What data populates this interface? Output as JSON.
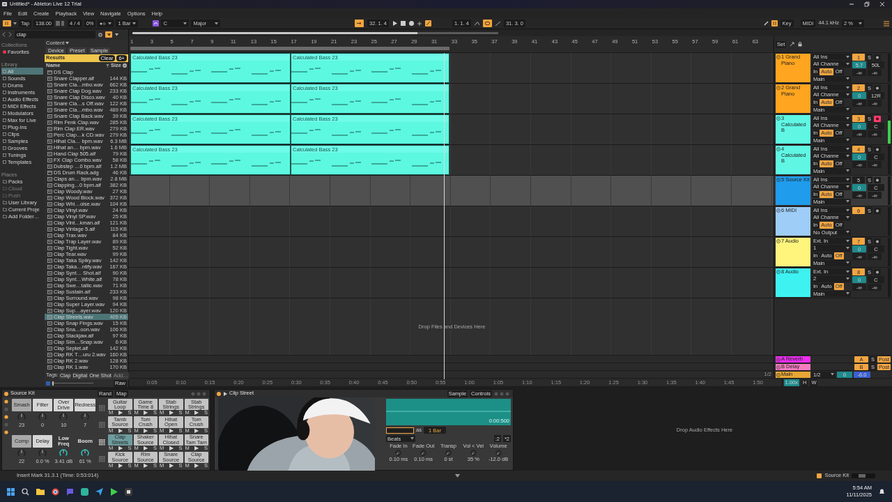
{
  "window": {
    "title": "Untitled* - Ableton Live 12 Trial"
  },
  "menu": [
    "File",
    "Edit",
    "Create",
    "Playback",
    "View",
    "Navigate",
    "Options",
    "Help"
  ],
  "transport": {
    "tap": "Tap",
    "tempo": "138.00",
    "signature": "4 / 4",
    "groove": "0%",
    "quantize": "1 Bar",
    "key": "C",
    "scale": "Major",
    "follow": true,
    "position": "32. 1. 4",
    "loop_start": "1. 1. 4",
    "loop": true,
    "loop_length": "31. 3. 0",
    "key_map": "Key",
    "midi_map": "MIDI",
    "sample_rate": "44.1 kHz",
    "cpu": "2 %"
  },
  "browser": {
    "search": "clap",
    "collections_title": "Collections",
    "favorites": "Favorites",
    "library_title": "Library",
    "library": [
      {
        "label": "All",
        "selected": true
      },
      {
        "label": "Sounds",
        "selected": false
      },
      {
        "label": "Drums",
        "selected": false
      },
      {
        "label": "Instruments",
        "selected": false
      },
      {
        "label": "Audio Effects",
        "selected": false
      },
      {
        "label": "MIDI Effects",
        "selected": false
      },
      {
        "label": "Modulators",
        "selected": false
      },
      {
        "label": "Max for Live",
        "selected": false
      },
      {
        "label": "Plug-Ins",
        "selected": false
      },
      {
        "label": "Clips",
        "selected": false
      },
      {
        "label": "Samples",
        "selected": false
      },
      {
        "label": "Grooves",
        "selected": false
      },
      {
        "label": "Tunings",
        "selected": false
      },
      {
        "label": "Templates",
        "selected": false
      }
    ],
    "places_title": "Places",
    "places": [
      {
        "label": "Packs",
        "disabled": false
      },
      {
        "label": "Cloud",
        "disabled": true
      },
      {
        "label": "Push",
        "disabled": true
      },
      {
        "label": "User Library",
        "disabled": false
      },
      {
        "label": "Current Proje",
        "disabled": false
      },
      {
        "label": "Add Folder…",
        "disabled": false
      }
    ],
    "content": "Content",
    "filters": [
      "Device",
      "Preset",
      "Sample"
    ],
    "results": "Results",
    "clear": "Clear",
    "count": "6+",
    "name_column": "Name",
    "size_column": "Size",
    "rows": [
      {
        "name": "DS Clap",
        "size": "",
        "kind": "rack",
        "selected": false
      },
      {
        "name": "Snare Clapper.aif",
        "size": "144 KB",
        "kind": "sample",
        "selected": false
      },
      {
        "name": "Snare Cla…mbo.wav",
        "size": "662 KB",
        "kind": "sample",
        "selected": false
      },
      {
        "name": "Snare Clap Dog.wav",
        "size": "233 KB",
        "kind": "sample",
        "selected": false
      },
      {
        "name": "Snare Clap Disco.wav",
        "size": "40 KB",
        "kind": "sample",
        "selected": false
      },
      {
        "name": "Snare Cla…s Off.wav",
        "size": "122 KB",
        "kind": "sample",
        "selected": false
      },
      {
        "name": "Snare Cla…mbo.wav",
        "size": "489 KB",
        "kind": "sample",
        "selected": false
      },
      {
        "name": "Snare Clap Back.wav",
        "size": "39 KB",
        "kind": "sample",
        "selected": false
      },
      {
        "name": "Rim Fenk Clap.wav",
        "size": "285 KB",
        "kind": "sample",
        "selected": false
      },
      {
        "name": "Rim Clap ER.wav",
        "size": "279 KB",
        "kind": "sample",
        "selected": false
      },
      {
        "name": "Perc Clap…k CD.wav",
        "size": "279 KB",
        "kind": "sample",
        "selected": false
      },
      {
        "name": "Hihat Cla… bpm.wav",
        "size": "6.3 MB",
        "kind": "sample",
        "selected": false
      },
      {
        "name": "Hihat an… bpm.wav",
        "size": "1.6 MB",
        "kind": "sample",
        "selected": false
      },
      {
        "name": "Hand Clap 505.aif",
        "size": "79 KB",
        "kind": "sample",
        "selected": false
      },
      {
        "name": "FX Clap Combo.wav",
        "size": "58 KB",
        "kind": "sample",
        "selected": false
      },
      {
        "name": "Dubstep …0 bpm.aif",
        "size": "1.2 MB",
        "kind": "sample",
        "selected": false
      },
      {
        "name": "DS Drum Rack.adg",
        "size": "46 KB",
        "kind": "rack",
        "selected": false
      },
      {
        "name": "Claps an… bpm.wav",
        "size": "2.8 MB",
        "kind": "sample",
        "selected": false
      },
      {
        "name": "Clapping…0 bpm.aif",
        "size": "382 KB",
        "kind": "sample",
        "selected": false
      },
      {
        "name": "Clap Woody.wav",
        "size": "27 KB",
        "kind": "sample",
        "selected": false
      },
      {
        "name": "Clap Wood Block.wav",
        "size": "372 KB",
        "kind": "sample",
        "selected": false
      },
      {
        "name": "Clap Whi…oise.wav",
        "size": "104 KB",
        "kind": "sample",
        "selected": false
      },
      {
        "name": "Clap Vinyl.wav",
        "size": "24 KB",
        "kind": "sample",
        "selected": false
      },
      {
        "name": "Clap Vinyl SP.wav",
        "size": "25 KB",
        "kind": "sample",
        "selected": false
      },
      {
        "name": "Clap Vint…kman.aif",
        "size": "121 KB",
        "kind": "sample",
        "selected": false
      },
      {
        "name": "Clap Vintage 5.aif",
        "size": "115 KB",
        "kind": "sample",
        "selected": false
      },
      {
        "name": "Clap Trax.wav",
        "size": "84 KB",
        "kind": "sample",
        "selected": false
      },
      {
        "name": "Clap Trap Layer.wav",
        "size": "89 KB",
        "kind": "sample",
        "selected": false
      },
      {
        "name": "Clap Tight.wav",
        "size": "52 KB",
        "kind": "sample",
        "selected": false
      },
      {
        "name": "Clap Tear.wav",
        "size": "99 KB",
        "kind": "sample",
        "selected": false
      },
      {
        "name": "Clap Taka Spiky.wav",
        "size": "142 KB",
        "kind": "sample",
        "selected": false
      },
      {
        "name": "Clap Taka…ntify.wav",
        "size": "167 KB",
        "kind": "sample",
        "selected": false
      },
      {
        "name": "Clap Synt… Shot.aif",
        "size": "90 KB",
        "kind": "sample",
        "selected": false
      },
      {
        "name": "Clap Synt…White.aif",
        "size": "78 KB",
        "kind": "sample",
        "selected": false
      },
      {
        "name": "Clap Swe…tallic.wav",
        "size": "71 KB",
        "kind": "sample",
        "selected": false
      },
      {
        "name": "Clap Sustain.aif",
        "size": "233 KB",
        "kind": "sample",
        "selected": false
      },
      {
        "name": "Clap Surround.wav",
        "size": "98 KB",
        "kind": "sample",
        "selected": false
      },
      {
        "name": "Clap Super Layer.wav",
        "size": "94 KB",
        "kind": "sample",
        "selected": false
      },
      {
        "name": "Clap Sup…ayer.wav",
        "size": "120 KB",
        "kind": "sample",
        "selected": false
      },
      {
        "name": "Clap Streets.wav",
        "size": "405 KB",
        "kind": "sample",
        "selected": true
      },
      {
        "name": "Clap Snap Fings.wav",
        "size": "15 KB",
        "kind": "sample",
        "selected": false
      },
      {
        "name": "Clap Sna…oon.wav",
        "size": "106 KB",
        "kind": "sample",
        "selected": false
      },
      {
        "name": "Clap Stackjaw.aif",
        "size": "97 KB",
        "kind": "sample",
        "selected": false
      },
      {
        "name": "Clap Sim…Snap.wav",
        "size": "6 KB",
        "kind": "sample",
        "selected": false
      },
      {
        "name": "Clap Septet.aif",
        "size": "142 KB",
        "kind": "sample",
        "selected": false
      },
      {
        "name": "Clap RK T…uru 2.wav",
        "size": "160 KB",
        "kind": "sample",
        "selected": false
      },
      {
        "name": "Clap RK 2.wav",
        "size": "128 KB",
        "kind": "sample",
        "selected": false
      },
      {
        "name": "Clap RK 1.wav",
        "size": "170 KB",
        "kind": "sample",
        "selected": false
      }
    ],
    "preview": {
      "level": 0.02
    },
    "tags_label": "Tags:",
    "tags": [
      {
        "label": "Clap",
        "disabled": false
      },
      {
        "label": "Digital",
        "disabled": false
      },
      {
        "label": "One Shot",
        "disabled": false
      },
      {
        "label": "Add…",
        "disabled": true
      }
    ],
    "raw": "Raw"
  },
  "arrangement": {
    "bar_labels": [
      "1",
      "3",
      "5",
      "7",
      "9",
      "11",
      "13",
      "15",
      "17",
      "19",
      "21",
      "23",
      "25",
      "27",
      "29",
      "31",
      "33",
      "35",
      "37",
      "39",
      "41",
      "43",
      "45",
      "47",
      "49",
      "51",
      "53",
      "55",
      "57",
      "59",
      "61",
      "63"
    ],
    "set_button": "Set",
    "tracks": [
      {
        "name": "1 Grand Piano",
        "color": "#ffa51f",
        "selected": false,
        "clips": [
          "Calculated Bass 23",
          "Calculated Bass 23"
        ],
        "input": "All Ins",
        "channel": "All Channe",
        "monitor": [
          {
            "label": "In",
            "selected": false
          },
          {
            "label": "Auto",
            "selected": true
          },
          {
            "label": "Off",
            "selected": false
          }
        ],
        "output": "Main",
        "number": "1",
        "number_on": true,
        "solo": "S",
        "armed": false,
        "volume": "5.7",
        "pan": "50L",
        "sends": [
          "-∞",
          "-∞"
        ],
        "level": 0
      },
      {
        "name": "2 Grand Piano",
        "color": "#ffa51f",
        "selected": false,
        "clips": [
          "Calculated Bass 23",
          "Calculated Bass 23"
        ],
        "input": "All Ins",
        "channel": "All Channe",
        "monitor": [
          {
            "label": "In",
            "selected": false
          },
          {
            "label": "Auto",
            "selected": true
          },
          {
            "label": "Off",
            "selected": false
          }
        ],
        "output": "Main",
        "number": "2",
        "number_on": true,
        "solo": "S",
        "armed": false,
        "volume": "0",
        "pan": "12R",
        "sends": [
          "-∞",
          "-∞"
        ],
        "level": 0
      },
      {
        "name": "3 Calculated B",
        "color": "#5ff7e4",
        "selected": false,
        "clips": [
          "Calculated Bass 23",
          "Calculated Bass 23"
        ],
        "input": "All Ins",
        "channel": "All Channe",
        "monitor": [
          {
            "label": "In",
            "selected": false
          },
          {
            "label": "Auto",
            "selected": true
          },
          {
            "label": "Off",
            "selected": false
          }
        ],
        "output": "Main",
        "number": "3",
        "number_on": true,
        "solo": "S",
        "armed": true,
        "volume": "0",
        "pan": "C",
        "sends": [
          "-∞",
          "-∞"
        ],
        "level": 0.8
      },
      {
        "name": "4 Calculated B",
        "color": "#5ff7e4",
        "selected": false,
        "clips": [
          "Calculated Bass 23",
          "Calculated Bass 23"
        ],
        "input": "All Ins",
        "channel": "All Channe",
        "monitor": [
          {
            "label": "In",
            "selected": false
          },
          {
            "label": "Auto",
            "selected": true
          },
          {
            "label": "Off",
            "selected": false
          }
        ],
        "output": "Main",
        "number": "4",
        "number_on": true,
        "solo": "S",
        "armed": false,
        "volume": "0",
        "pan": "C",
        "sends": [
          "-∞",
          "-∞"
        ],
        "level": 0
      },
      {
        "name": "5 Source Kit",
        "color": "#1f9cec",
        "selected": true,
        "input": "All Ins",
        "channel": "All Channe",
        "monitor": [
          {
            "label": "In",
            "selected": false
          },
          {
            "label": "Auto",
            "selected": true
          },
          {
            "label": "Off",
            "selected": false
          }
        ],
        "output": "Main",
        "number": "5",
        "number_on": false,
        "solo": "S",
        "armed": false,
        "volume": "0",
        "pan": "C",
        "sends": [
          "-∞",
          "-∞"
        ],
        "level": 0
      },
      {
        "name": "6 MIDI",
        "color": "#9ecdf7",
        "selected": false,
        "input": "All Ins",
        "channel": "All Channe",
        "monitor": [
          {
            "label": "In",
            "selected": false
          },
          {
            "label": "Auto",
            "selected": true
          },
          {
            "label": "Off",
            "selected": false
          }
        ],
        "output": "No Output",
        "number": "6",
        "number_on": true,
        "solo": "S",
        "armed": false,
        "level": 0
      },
      {
        "name": "7 Audio",
        "color": "#fff57c",
        "selected": false,
        "input": "Ext. In",
        "channel": "1",
        "monitor": [
          {
            "label": "In",
            "selected": false
          },
          {
            "label": "Auto",
            "selected": false
          },
          {
            "label": "Off",
            "selected": true
          }
        ],
        "output": "Main",
        "number": "7",
        "number_on": true,
        "solo": "S",
        "armed": false,
        "volume": "0",
        "pan": "C",
        "sends": [
          "-∞",
          "-∞"
        ],
        "level": 0
      },
      {
        "name": "8 Audio",
        "color": "#3ef2f2",
        "selected": false,
        "input": "Ext. In",
        "channel": "2",
        "monitor": [
          {
            "label": "In",
            "selected": false
          },
          {
            "label": "Auto",
            "selected": false
          },
          {
            "label": "Off",
            "selected": true
          }
        ],
        "output": "Main",
        "number": "8",
        "number_on": true,
        "solo": "S",
        "armed": false,
        "volume": "0",
        "pan": "C",
        "sends": [
          "-∞",
          "-∞"
        ],
        "level": 0
      }
    ],
    "drop_hint": "Drop Files and Devices Here",
    "returns": [
      {
        "kind": "return",
        "name": "A Reverb",
        "color": "#ec2ef0",
        "number": "A",
        "solo": "S",
        "post": "Post"
      },
      {
        "kind": "return",
        "name": "B Delay",
        "color": "#f57cc0",
        "number": "B",
        "solo": "S",
        "post": "Post"
      },
      {
        "kind": "main",
        "name": "Main",
        "color": "#e7a634",
        "input": "1/2",
        "volume": "0",
        "pan": "-6.0"
      }
    ],
    "zoom_label": "1/2",
    "time_labels": [
      "0:05",
      "0:10",
      "0:15",
      "0:20",
      "0:25",
      "0:30",
      "0:35",
      "0:40",
      "0:45",
      "0:50",
      "0:55",
      "1:00",
      "1:05",
      "1:10",
      "1:15",
      "1:20",
      "1:25",
      "1:30",
      "1:35",
      "1:40",
      "1:45",
      "1:50"
    ],
    "speed": "1.00x",
    "h_button": "H",
    "w_button": "W"
  },
  "devices": {
    "drum_rack": {
      "title": "Source Kit",
      "rand": "Rand",
      "map": "Map",
      "macros": [
        {
          "label": "Smash",
          "kind": "button",
          "lit": false,
          "value": "23",
          "highlighted": false
        },
        {
          "label": "Filter",
          "kind": "button",
          "lit": true,
          "value": "0",
          "highlighted": false
        },
        {
          "label": "Over Drive",
          "kind": "button",
          "lit": true,
          "value": "10",
          "highlighted": false
        },
        {
          "label": "Redness",
          "kind": "button",
          "lit": true,
          "value": "7",
          "highlighted": false
        },
        {
          "label": "Comp",
          "kind": "button",
          "lit": false,
          "value": "22",
          "highlighted": false
        },
        {
          "label": "Delay",
          "kind": "button",
          "lit": true,
          "value": "0.0 %",
          "highlighted": false
        },
        {
          "label": "Low Freq",
          "kind": "label",
          "lit": false,
          "value": "3.41 dB",
          "highlighted": true
        },
        {
          "label": "Boom",
          "kind": "label",
          "lit": false,
          "value": "61 %",
          "highlighted": true
        }
      ],
      "pads": [
        {
          "name": "Guitar Loop",
          "selected": false,
          "mute": "M",
          "play": "▶",
          "solo": "S"
        },
        {
          "name": "Game Time 8",
          "selected": false,
          "mute": "M",
          "play": "▶",
          "solo": "S"
        },
        {
          "name": "Stab Strings",
          "selected": false,
          "mute": "M",
          "play": "▶",
          "solo": "S"
        },
        {
          "name": "Stab Strings",
          "selected": false,
          "mute": "M",
          "play": "▶",
          "solo": "S"
        },
        {
          "name": "Tamb Source",
          "selected": false,
          "mute": "M",
          "play": "▶",
          "solo": "S"
        },
        {
          "name": "Tom Crush",
          "selected": false,
          "mute": "M",
          "play": "▶",
          "solo": "S"
        },
        {
          "name": "Hihat Open",
          "selected": false,
          "mute": "M",
          "play": "▶",
          "solo": "S"
        },
        {
          "name": "Tom Crush",
          "selected": false,
          "mute": "M",
          "play": "▶",
          "solo": "S"
        },
        {
          "name": "Clap Streets",
          "selected": true,
          "mute": "M",
          "play": "▶",
          "solo": "S"
        },
        {
          "name": "Shaker Source",
          "selected": false,
          "mute": "M",
          "play": "▶",
          "solo": "S"
        },
        {
          "name": "Hihat Closed",
          "selected": false,
          "mute": "M",
          "play": "▶",
          "solo": "S"
        },
        {
          "name": "Snare Tam Tam",
          "selected": false,
          "mute": "M",
          "play": "▶",
          "solo": "S"
        },
        {
          "name": "Kick Source",
          "selected": false,
          "mute": "M",
          "play": "▶",
          "solo": "S"
        },
        {
          "name": "Rim Source",
          "selected": false,
          "mute": "M",
          "play": "▶",
          "solo": "S"
        },
        {
          "name": "Snare Source",
          "selected": false,
          "mute": "M",
          "play": "▶",
          "solo": "S"
        },
        {
          "name": "Clap Source",
          "selected": false,
          "mute": "M",
          "play": "▶",
          "solo": "S"
        }
      ]
    },
    "sampler": {
      "title": "Clip Street",
      "tabs": [
        "Sample",
        "Controls"
      ],
      "waveform_time": "0:00:500",
      "as": "as",
      "warp_length": "1 Bar",
      "warp_mode": "Beats",
      "halve": ":2",
      "double": "*2",
      "params": [
        {
          "label": "Fade In",
          "value": "0.10 ms"
        },
        {
          "label": "Fade Out",
          "value": "0.10 ms"
        },
        {
          "label": "Transp",
          "value": "0 st"
        },
        {
          "label": "Vol < Vel",
          "value": "35 %"
        },
        {
          "label": "Volume",
          "value": "-12.0 dB"
        }
      ]
    },
    "drop_hint": "Drop Audio Effects Here"
  },
  "status_bar": {
    "message": "Insert Mark 31.3.1 (Time: 0:53:014)",
    "device": "Source Kit"
  },
  "taskbar": {
    "time": "5:54 AM",
    "date": "11/11/2025"
  }
}
